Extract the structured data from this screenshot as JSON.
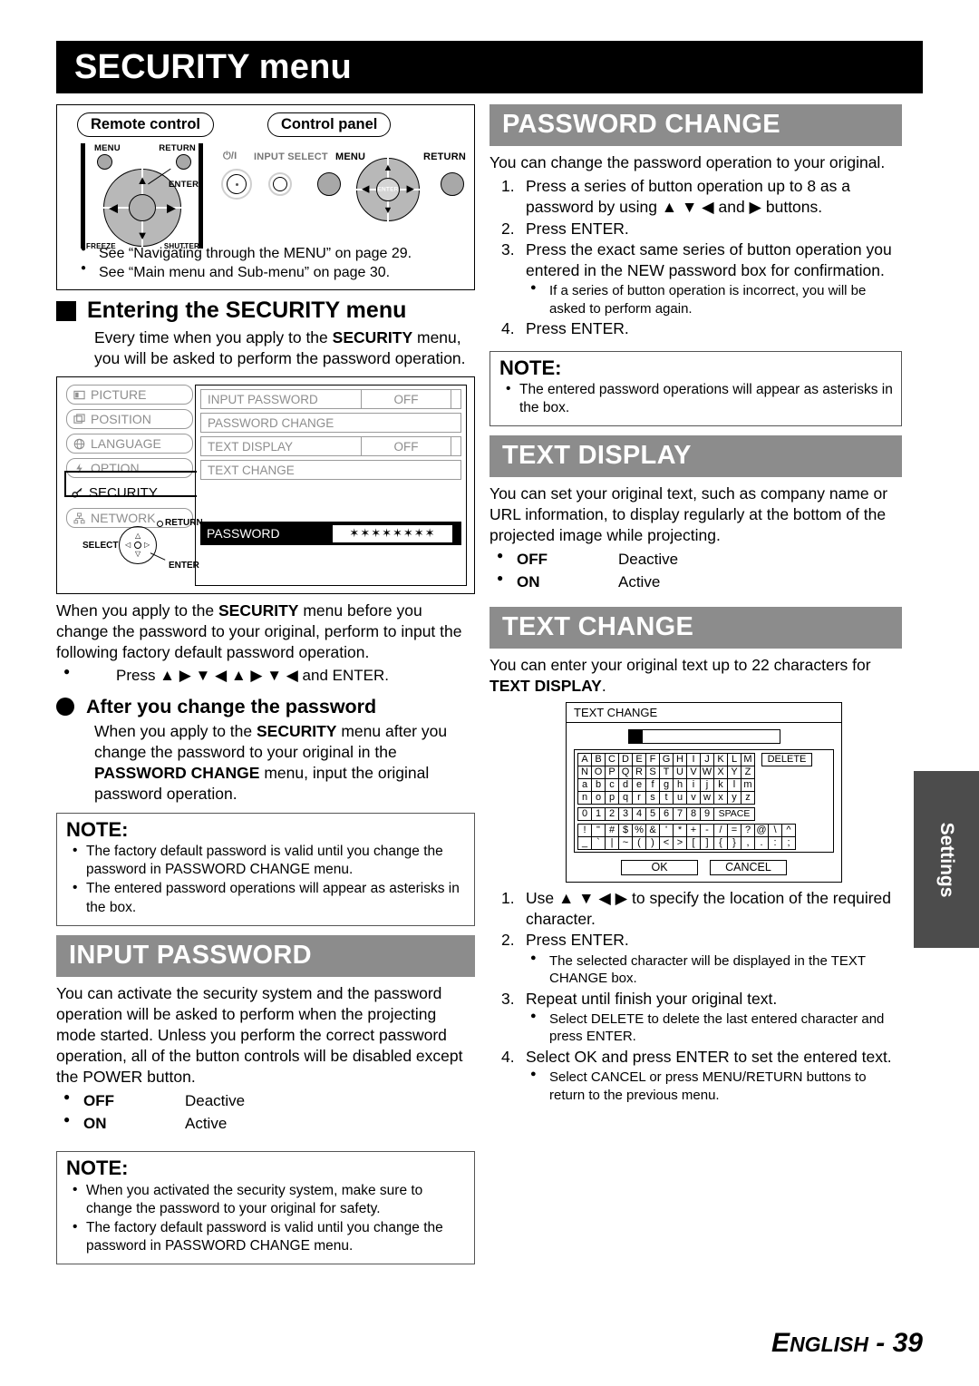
{
  "page": {
    "title": "SECURITY menu",
    "footer_prefix": "E",
    "footer_rest": "NGLISH",
    "footer_page": "- 39",
    "side_tab": "Settings"
  },
  "figure_remote": {
    "remote_label": "Remote control",
    "panel_label": "Control panel",
    "remote_buttons": {
      "menu": "MENU",
      "return": "RETURN",
      "enter": "ENTER",
      "freeze": "FREEZE",
      "shutter": "SHUTTER"
    },
    "panel_buttons": {
      "power": "⏻/I",
      "input_select": "INPUT SELECT",
      "menu": "MENU",
      "enter": "ENTER",
      "return": "RETURN"
    },
    "notes": [
      "See “Navigating through the MENU” on page 29.",
      "See “Main menu and Sub-menu” on page 30."
    ]
  },
  "entering": {
    "heading": "Entering the SECURITY menu",
    "intro_1": "Every time when you apply to the ",
    "intro_bold": "SECURITY",
    "intro_2": " menu, you will be asked to perform the password operation."
  },
  "osd": {
    "menu_items": [
      {
        "label": "PICTURE",
        "icon": "picture-icon"
      },
      {
        "label": "POSITION",
        "icon": "position-icon"
      },
      {
        "label": "LANGUAGE",
        "icon": "globe-icon"
      },
      {
        "label": "OPTION",
        "icon": "option-icon"
      },
      {
        "label": "SECURITY",
        "icon": "key-icon"
      },
      {
        "label": "NETWORK",
        "icon": "network-icon"
      }
    ],
    "rows": [
      {
        "name": "INPUT PASSWORD",
        "value": "OFF"
      },
      {
        "name": "PASSWORD CHANGE",
        "value": ""
      },
      {
        "name": "TEXT DISPLAY",
        "value": "OFF"
      },
      {
        "name": "TEXT CHANGE",
        "value": ""
      }
    ],
    "password_row": {
      "name": "PASSWORD",
      "value": "✶✶✶✶✶✶✶✶"
    },
    "nav": {
      "select": "SELECT",
      "return": "RETURN",
      "enter": "ENTER"
    }
  },
  "before_change": {
    "p1_a": "When you apply to the ",
    "p1_b": "SECURITY",
    "p1_c": " menu before you change the password to your original, perform to input the following factory default password operation.",
    "bullet": "Press ▲ ▶ ▼ ◀ ▲ ▶ ▼ ◀ and ENTER."
  },
  "after_change": {
    "heading": "After you change the password",
    "p_a": "When you apply to the ",
    "p_b": "SECURITY",
    "p_c": " menu after you change the password to your original in the ",
    "p_d": "PASSWORD CHANGE",
    "p_e": " menu, input the original password operation."
  },
  "note_left_1": {
    "title": "NOTE:",
    "items": [
      "The factory default password is valid until you change the password in PASSWORD CHANGE menu.",
      "The entered password operations will appear as asterisks in the box."
    ]
  },
  "input_password": {
    "heading": "INPUT PASSWORD",
    "body": "You can activate the security system and the password operation will be asked to perform when the projecting mode started. Unless you perform the correct password operation, all of the button controls will be disabled except the POWER button.",
    "options": [
      {
        "key": "OFF",
        "value": "Deactive"
      },
      {
        "key": "ON",
        "value": "Active"
      }
    ]
  },
  "note_left_2": {
    "title": "NOTE:",
    "items": [
      "When you activated the security system, make sure to change the password to your original for safety.",
      "The factory default password is valid until you change the password in PASSWORD CHANGE menu."
    ]
  },
  "password_change": {
    "heading": "PASSWORD CHANGE",
    "intro": "You can change the password operation to your original.",
    "steps": [
      {
        "num": "1.",
        "text": "Press a series of button operation up to 8 as a password by using ▲ ▼ ◀ and ▶ buttons."
      },
      {
        "num": "2.",
        "text": "Press ENTER."
      },
      {
        "num": "3.",
        "text": "Press the exact same series of button operation you entered in the NEW password box for confirmation."
      },
      {
        "num": "4.",
        "text": "Press ENTER."
      }
    ],
    "sub_bullet": "If a series of button operation is incorrect, you will be asked to perform again."
  },
  "note_right": {
    "title": "NOTE:",
    "items": [
      "The entered password operations will appear as asterisks in the box."
    ]
  },
  "text_display": {
    "heading": "TEXT DISPLAY",
    "body": "You can set your original text, such as company name or URL information, to display regularly at the bottom of the projected image while projecting.",
    "options": [
      {
        "key": "OFF",
        "value": "Deactive"
      },
      {
        "key": "ON",
        "value": "Active"
      }
    ]
  },
  "text_change": {
    "heading": "TEXT CHANGE",
    "body_a": "You can enter your original text up to 22 characters for ",
    "body_b": "TEXT DISPLAY",
    "body_c": ".",
    "dialog": {
      "title": "TEXT CHANGE",
      "input_value": "",
      "delete_label": "DELETE",
      "space_label": "SPACE",
      "ok_label": "OK",
      "cancel_label": "CANCEL",
      "rows": [
        [
          "A",
          "B",
          "C",
          "D",
          "E",
          "F",
          "G",
          "H",
          "I",
          "J",
          "K",
          "L",
          "M"
        ],
        [
          "N",
          "O",
          "P",
          "Q",
          "R",
          "S",
          "T",
          "U",
          "V",
          "W",
          "X",
          "Y",
          "Z"
        ],
        [
          "a",
          "b",
          "c",
          "d",
          "e",
          "f",
          "g",
          "h",
          "i",
          "j",
          "k",
          "l",
          "m"
        ],
        [
          "n",
          "o",
          "p",
          "q",
          "r",
          "s",
          "t",
          "u",
          "v",
          "w",
          "x",
          "y",
          "z"
        ],
        [
          "0",
          "1",
          "2",
          "3",
          "4",
          "5",
          "6",
          "7",
          "8",
          "9"
        ],
        [
          "!",
          "\"",
          "#",
          "$",
          "%",
          "&",
          "'",
          "*",
          "+",
          "-",
          "/",
          "=",
          "?",
          "@",
          "\\",
          "^"
        ],
        [
          "_",
          "`",
          "|",
          "~",
          "(",
          ")",
          "<",
          ">",
          "[",
          "]",
          "{",
          "}",
          ",",
          ".",
          ":",
          ";"
        ]
      ]
    },
    "steps": [
      {
        "num": "1.",
        "text": "Use ▲ ▼ ◀ ▶ to specify the location of the required character."
      },
      {
        "num": "2.",
        "text": "Press ENTER."
      },
      {
        "num": "3.",
        "text": "Repeat until finish your original text."
      },
      {
        "num": "4.",
        "text": "Select OK and press ENTER to set the entered text."
      }
    ],
    "sub_2": "The selected character will be displayed in the TEXT CHANGE box.",
    "sub_3": "Select DELETE to delete the last entered character and press ENTER.",
    "sub_4": "Select CANCEL or press MENU/RETURN buttons to return to the previous menu."
  }
}
